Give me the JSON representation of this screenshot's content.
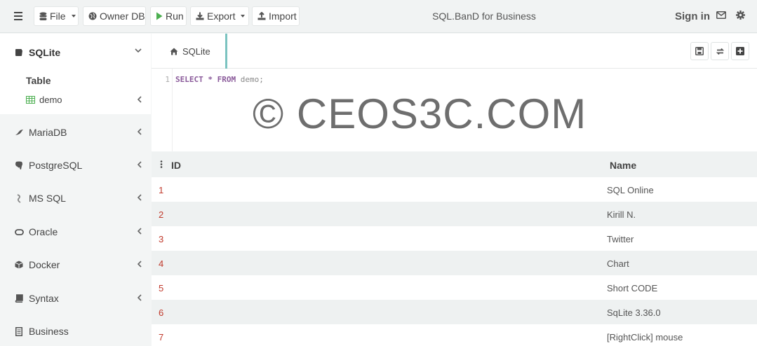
{
  "header": {
    "file_label": "File",
    "owner_db_label": "Owner DB",
    "run_label": "Run",
    "export_label": "Export",
    "import_label": "Import",
    "app_title": "SQL.BanD for Business",
    "signin_label": "Sign in"
  },
  "sidebar": {
    "active_db": "SQLite",
    "section_label": "Table",
    "table_item": "demo",
    "items": [
      "MariaDB",
      "PostgreSQL",
      "MS SQL",
      "Oracle",
      "Docker",
      "Syntax",
      "Business"
    ]
  },
  "editor": {
    "tab_label": "SQLite",
    "line_number": "1",
    "code": {
      "kw_select": "SELECT",
      "star": "*",
      "kw_from": "FROM",
      "table": "demo;"
    },
    "watermark": "© CEOS3C.COM"
  },
  "grid": {
    "columns": [
      "ID",
      "Name"
    ],
    "rows": [
      {
        "id": "1",
        "name": "SQL Online"
      },
      {
        "id": "2",
        "name": "Kirill N."
      },
      {
        "id": "3",
        "name": "Twitter"
      },
      {
        "id": "4",
        "name": "Chart"
      },
      {
        "id": "5",
        "name": "Short CODE"
      },
      {
        "id": "6",
        "name": "SqLite 3.36.0"
      },
      {
        "id": "7",
        "name": "[RightClick] mouse"
      }
    ]
  },
  "colors": {
    "accent": "#7bc3c0",
    "id_text": "#c0392b",
    "run_icon": "#4caf50",
    "table_icon": "#4caf50"
  }
}
